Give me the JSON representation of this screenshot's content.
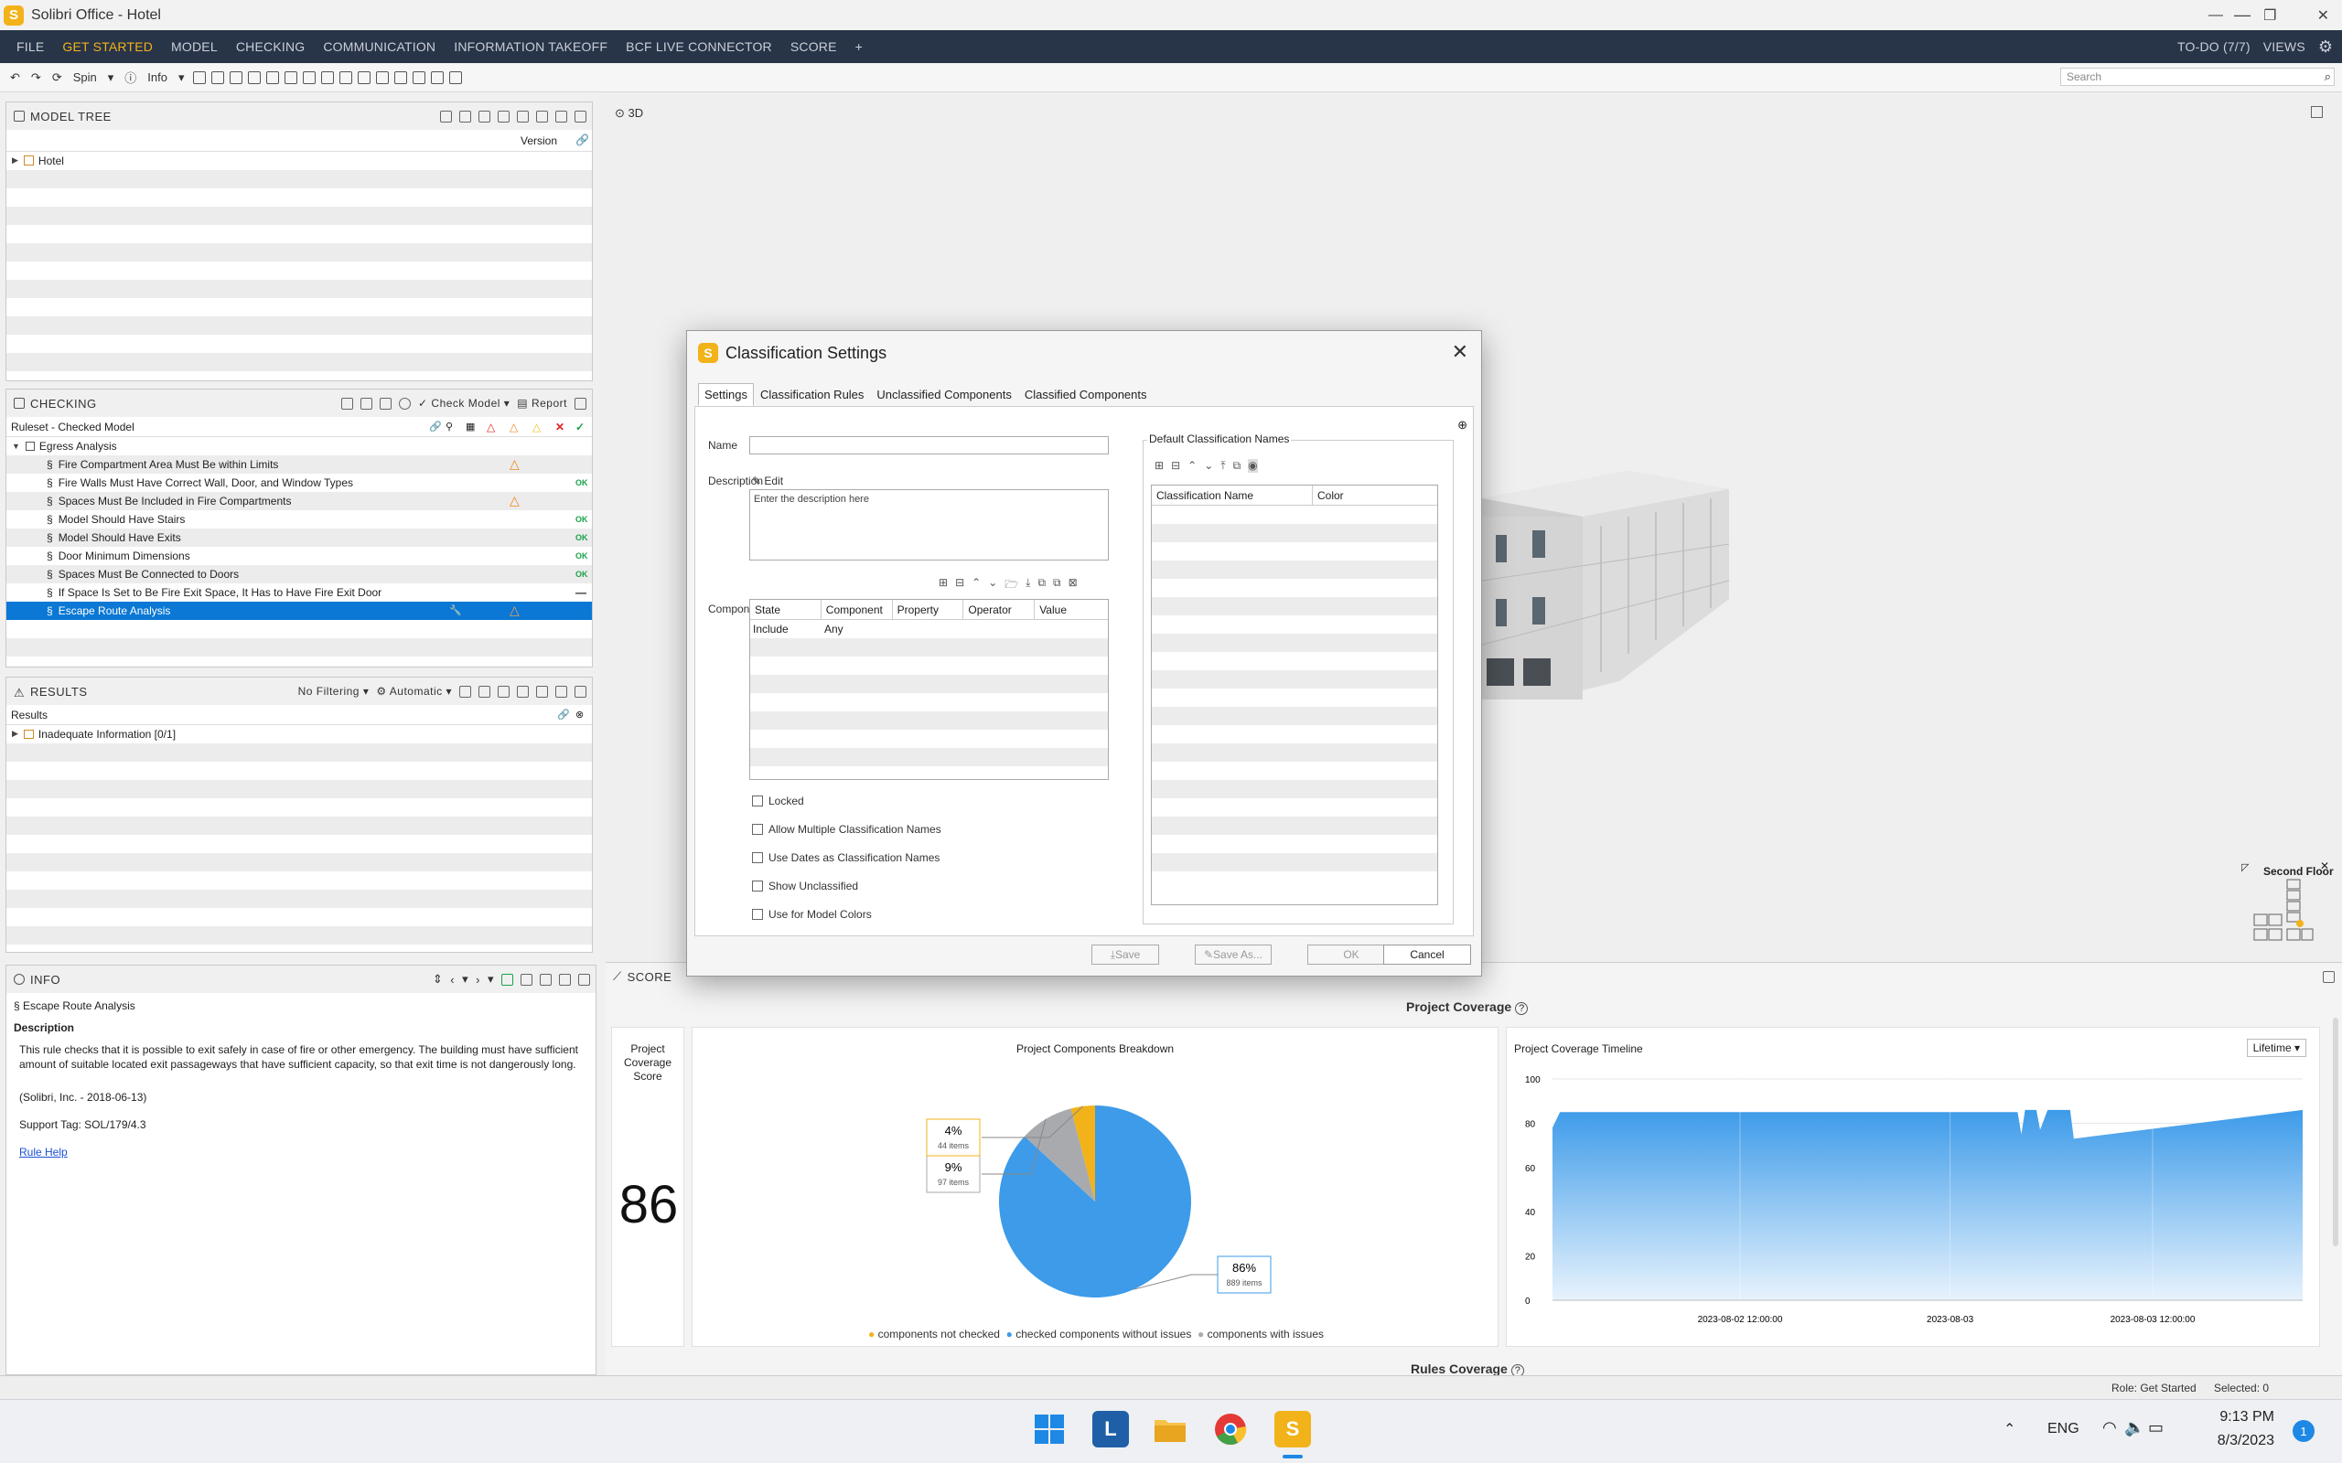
{
  "window": {
    "title": "Solibri Office - Hotel",
    "app_letter": "S"
  },
  "menu": {
    "items": [
      "FILE",
      "GET STARTED",
      "MODEL",
      "CHECKING",
      "COMMUNICATION",
      "INFORMATION TAKEOFF",
      "BCF LIVE CONNECTOR",
      "SCORE",
      "+"
    ],
    "active": "GET STARTED",
    "todo": "TO-DO (7/7)",
    "views": "VIEWS"
  },
  "toolbar": {
    "spin": "Spin",
    "info": "Info",
    "search_placeholder": "Search"
  },
  "model_tree": {
    "title": "MODEL TREE",
    "version_col": "Version",
    "root": "Hotel"
  },
  "checking": {
    "title": "CHECKING",
    "check_model": "Check Model",
    "report": "Report",
    "ruleset": "Ruleset - Checked Model",
    "group": "Egress Analysis",
    "rules": [
      {
        "name": "Fire Compartment Area Must Be within Limits",
        "status": "warn"
      },
      {
        "name": "Fire Walls Must Have Correct Wall, Door, and Window Types",
        "status": "OK"
      },
      {
        "name": "Spaces Must Be Included in Fire Compartments",
        "status": "warn"
      },
      {
        "name": "Model Should Have Stairs",
        "status": "OK"
      },
      {
        "name": "Model Should Have Exits",
        "status": "OK"
      },
      {
        "name": "Door Minimum Dimensions",
        "status": "OK"
      },
      {
        "name": "Spaces Must Be Connected to Doors",
        "status": "OK"
      },
      {
        "name": "If Space Is Set to Be Fire Exit Space, It Has to Have Fire Exit Door",
        "status": "dash"
      },
      {
        "name": "Escape Route Analysis",
        "status": "warn"
      }
    ],
    "selected_rule": "Escape Route Analysis"
  },
  "results": {
    "title": "RESULTS",
    "filter": "No Filtering",
    "mode": "Automatic",
    "header": "Results",
    "items": [
      "Inadequate Information [0/1]"
    ]
  },
  "info": {
    "title": "INFO",
    "rule_name": "Escape Route Analysis",
    "description_label": "Description",
    "description": "This rule checks that it is possible to exit safely in case of fire or other emergency. The building must have sufficient amount of suitable located exit passageways that have sufficient capacity, so that exit time is not dangerously long.",
    "author": "(Solibri, Inc. - 2018-06-13)",
    "support_tag": "Support Tag: SOL/179/4.3",
    "help_link": "Rule Help"
  },
  "view3d": {
    "label": "3D",
    "floor_label": "Second Floor"
  },
  "dialog": {
    "title": "Classification Settings",
    "tabs": [
      "Settings",
      "Classification Rules",
      "Unclassified Components",
      "Classified Components"
    ],
    "active_tab": "Settings",
    "name_label": "Name",
    "name_value": "",
    "description_label": "Description",
    "edit_label": "Edit",
    "description_placeholder": "Enter the description here",
    "components_label": "Components",
    "components_columns": [
      "State",
      "Component",
      "Property",
      "Operator",
      "Value"
    ],
    "components_rows": [
      [
        "Include",
        "Any",
        "",
        "",
        ""
      ]
    ],
    "checkboxes": [
      "Locked",
      "Allow Multiple Classification Names",
      "Use Dates as Classification Names",
      "Show Unclassified",
      "Use for Model Colors"
    ],
    "default_names_label": "Default Classification Names",
    "default_columns": [
      "Classification Name",
      "Color"
    ],
    "buttons": {
      "save": "Save",
      "save_as": "Save As...",
      "ok": "OK",
      "cancel": "Cancel"
    }
  },
  "score": {
    "title": "SCORE",
    "coverage_title": "Project Coverage",
    "score_card_label": "Project Coverage Score",
    "score_value": "86",
    "breakdown_title": "Project Components Breakdown",
    "timeline_title": "Project Coverage Timeline",
    "timeline_range": "Lifetime",
    "rules_coverage": "Rules Coverage",
    "legend": [
      "components not checked",
      "checked components without issues",
      "components with issues"
    ]
  },
  "chart_data": [
    {
      "type": "pie",
      "title": "Project Components Breakdown",
      "slices": [
        {
          "name": "checked components without issues",
          "percent": 86,
          "label": "86%",
          "items_label": "889 items",
          "color": "#3d9be9"
        },
        {
          "name": "components with issues",
          "percent": 9,
          "label": "9%",
          "items_label": "97 items",
          "color": "#a8aaae"
        },
        {
          "name": "components not checked",
          "percent": 4,
          "label": "4%",
          "items_label": "44 items",
          "color": "#f2b21a"
        }
      ]
    },
    {
      "type": "area",
      "title": "Project Coverage Timeline",
      "ylim": [
        0,
        100
      ],
      "yticks": [
        "100",
        "80",
        "60",
        "40",
        "20",
        "0"
      ],
      "xticks": [
        "2023-08-02 12:00:00",
        "2023-08-03",
        "2023-08-03 12:00:00"
      ],
      "points": [
        [
          0.0,
          78
        ],
        [
          0.01,
          85
        ],
        [
          0.62,
          85
        ],
        [
          0.625,
          75
        ],
        [
          0.63,
          86
        ],
        [
          0.645,
          86
        ],
        [
          0.65,
          77
        ],
        [
          0.66,
          86
        ],
        [
          0.69,
          86
        ],
        [
          0.695,
          73
        ],
        [
          1.0,
          86
        ]
      ],
      "color": "#3d9be9"
    }
  ],
  "statusbar": {
    "role": "Role: Get Started",
    "selected": "Selected: 0"
  },
  "taskbar": {
    "lang": "ENG",
    "time": "9:13 PM",
    "date": "8/3/2023",
    "notif": "1"
  }
}
